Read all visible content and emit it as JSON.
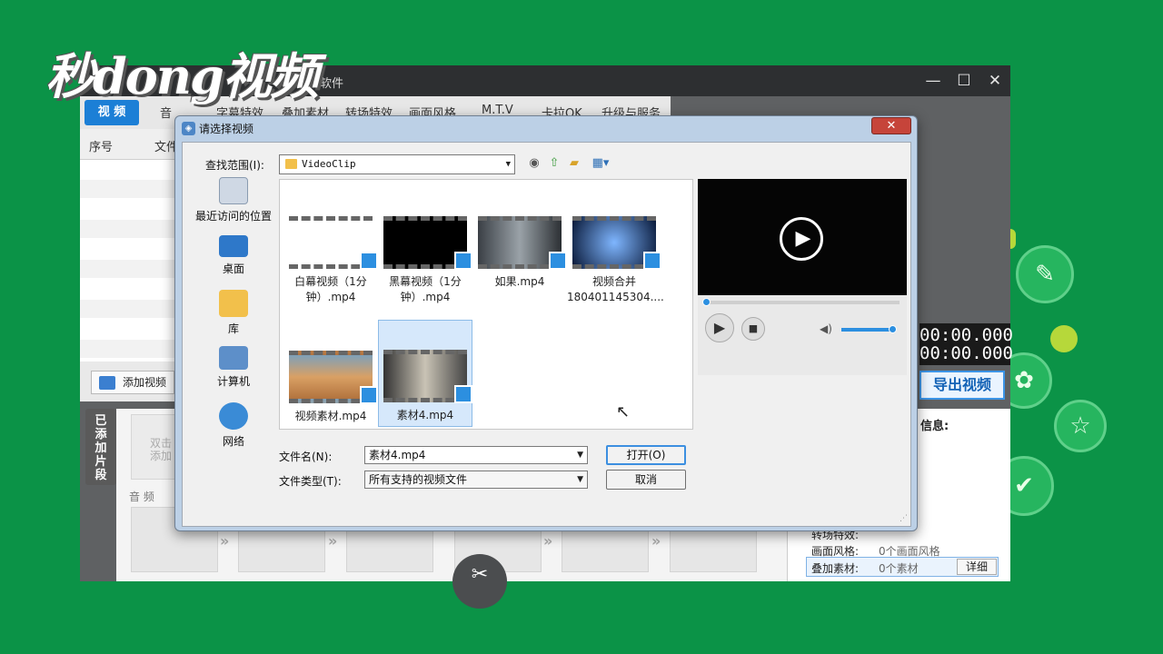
{
  "logo": "秒dong视频",
  "app": {
    "title": "剪辑软件",
    "window_buttons": [
      "—",
      "☐",
      "✕"
    ],
    "tabs": [
      "视 频",
      "音",
      "字幕特效",
      "叠加素材",
      "转场特效",
      "画面风格",
      "M.T.V",
      "卡拉OK",
      "升级与服务"
    ],
    "list_headers": [
      "序号",
      "文件"
    ],
    "add_video_label": "添加视频",
    "segment_label": "已添加片段",
    "segment_hint": "双击添加",
    "audio_label": "音 频",
    "timecodes": [
      "00:00.000",
      "00:00.000"
    ],
    "export_label": "导出视频",
    "info_title": "信息:",
    "info_rows": [
      {
        "label": "转场特效:",
        "value": ""
      },
      {
        "label": "画面风格:",
        "value": "0个画面风格"
      },
      {
        "label": "叠加素材:",
        "value": "0个素材"
      }
    ],
    "detail_label": "详细"
  },
  "dialog": {
    "title": "请选择视频",
    "close_label": "✕",
    "lookin_label": "查找范围(I):",
    "lookin_value": "VideoClip",
    "places": [
      "最近访问的位置",
      "桌面",
      "库",
      "计算机",
      "网络"
    ],
    "files": [
      {
        "name": "白幕视频（1分钟）.mp4",
        "line1": "白幕视频（1分",
        "line2": "钟）.mp4"
      },
      {
        "name": "黑幕视频（1分钟）.mp4",
        "line1": "黑幕视频（1分",
        "line2": "钟）.mp4"
      },
      {
        "name": "如果.mp4",
        "line1": "如果.mp4",
        "line2": ""
      },
      {
        "name": "视频合并180401145304....",
        "line1": "视频合并",
        "line2": "180401145304...."
      },
      {
        "name": "视频素材.mp4",
        "line1": "视频素材.mp4",
        "line2": ""
      },
      {
        "name": "素材4.mp4",
        "line1": "素材4.mp4",
        "line2": ""
      }
    ],
    "filename_label": "文件名(N):",
    "filename_value": "素材4.mp4",
    "filetype_label": "文件类型(T):",
    "filetype_value": "所有支持的视频文件",
    "open_label": "打开(O)",
    "cancel_label": "取消"
  },
  "colors": {
    "background": "#0b9347",
    "accent": "#2c8fe0",
    "app_tab_active": "#1c7fd6"
  },
  "icons": [
    "play-icon",
    "stop-icon",
    "volume-icon",
    "scissors-icon",
    "back-icon",
    "up-folder-icon",
    "new-folder-icon",
    "view-menu-icon"
  ]
}
